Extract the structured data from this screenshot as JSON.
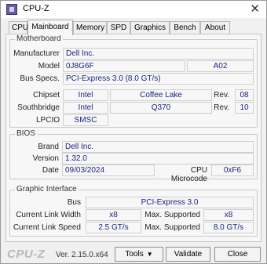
{
  "window": {
    "title": "CPU-Z",
    "close_symbol": "✕"
  },
  "tabs": [
    "CPU",
    "Mainboard",
    "Memory",
    "SPD",
    "Graphics",
    "Bench",
    "About"
  ],
  "active_tab": "Mainboard",
  "motherboard": {
    "group_title": "Motherboard",
    "manufacturer_label": "Manufacturer",
    "manufacturer": "Dell Inc.",
    "model_label": "Model",
    "model": "0J8G6F",
    "model_rev": "A02",
    "bus_label": "Bus Specs.",
    "bus": "PCI-Express 3.0 (8.0 GT/s)",
    "chipset_label": "Chipset",
    "chipset_vendor": "Intel",
    "chipset_name": "Coffee Lake",
    "chipset_rev_label": "Rev.",
    "chipset_rev": "08",
    "southbridge_label": "Southbridge",
    "southbridge_vendor": "Intel",
    "southbridge_name": "Q370",
    "southbridge_rev_label": "Rev.",
    "southbridge_rev": "10",
    "lpcio_label": "LPCIO",
    "lpcio": "SMSC"
  },
  "bios": {
    "group_title": "BIOS",
    "brand_label": "Brand",
    "brand": "Dell Inc.",
    "version_label": "Version",
    "version": "1.32.0",
    "date_label": "Date",
    "date": "09/03/2024",
    "microcode_label": "CPU Microcode",
    "microcode": "0xF6"
  },
  "graphic": {
    "group_title": "Graphic Interface",
    "bus_label": "Bus",
    "bus": "PCI-Express 3.0",
    "width_label": "Current Link Width",
    "width": "x8",
    "max_width_label": "Max. Supported",
    "max_width": "x8",
    "speed_label": "Current Link Speed",
    "speed": "2.5 GT/s",
    "max_speed_label": "Max. Supported",
    "max_speed": "8.0 GT/s"
  },
  "footer": {
    "brand": "CPU-Z",
    "version": "Ver. 2.15.0.x64",
    "tools_label": "Tools",
    "validate_label": "Validate",
    "close_label": "Close"
  }
}
